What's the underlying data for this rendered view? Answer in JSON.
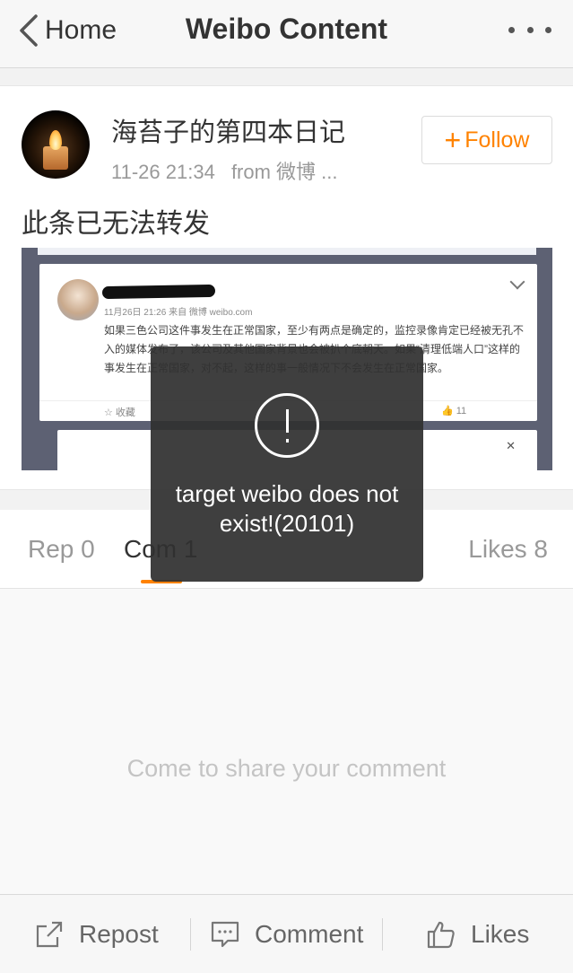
{
  "navbar": {
    "back_label": "Home",
    "title": "Weibo Content"
  },
  "post": {
    "author": "海苔子的第四本日记",
    "time": "11-26 21:34",
    "source": "from 微博 ...",
    "follow_label": "Follow",
    "text": "此条已无法转发",
    "image": {
      "meta": "11月26日 21:26 来自 微博 weibo.com",
      "body": "如果三色公司这件事发生在正常国家，至少有两点是确定的，监控录像肯定已经被无孔不入的媒体发布了，该公司及其他国家背景也会被扒个底朝天。如果“清理低端人口”这样的事发生在正常国家，对不起，这样的事一般情况下不会发生在正常国家。",
      "fav_label": "收藏",
      "like_count": "11"
    }
  },
  "tabs": {
    "repost": "Rep 0",
    "comment": "Com 1",
    "likes": "Likes 8"
  },
  "comments": {
    "empty_hint": "Come to share your comment"
  },
  "toolbar": {
    "repost": "Repost",
    "comment": "Comment",
    "likes": "Likes"
  },
  "toast": {
    "message": "target weibo does not exist!(20101)"
  },
  "colors": {
    "accent": "#ff8200",
    "toast_bg": "#303030"
  }
}
